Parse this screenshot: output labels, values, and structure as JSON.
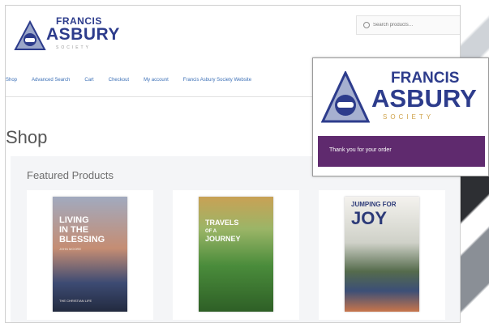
{
  "header": {
    "logo": {
      "line1": "FRANCIS",
      "line2": "ASBURY",
      "line3": "SOCIETY"
    },
    "search": {
      "placeholder": "Search products…"
    }
  },
  "nav": {
    "items": [
      "Shop",
      "Advanced Search",
      "Cart",
      "Checkout",
      "My account",
      "Francis Asbury Society Website"
    ]
  },
  "page": {
    "title": "Shop",
    "featured_title": "Featured Products"
  },
  "products": [
    {
      "title_line1": "LIVING",
      "title_line2": "IN THE",
      "title_line3": "BLESSING",
      "byline": "JOHN MOORE",
      "subtitle": "THE CHRISTIAN LIFE"
    },
    {
      "title_line1": "TRAVELS",
      "title_line2": "OF A",
      "title_line3": "JOURNEY"
    },
    {
      "title_line1": "JUMPING FOR",
      "title_line2": "JOY"
    }
  ],
  "overlay": {
    "logo": {
      "line1": "FRANCIS",
      "line2": "ASBURY",
      "line3": "SOCIETY"
    },
    "message": "Thank you for your order"
  },
  "colors": {
    "brand_blue": "#2d3c8c",
    "accent_gold": "#cfa24a",
    "banner_purple": "#5f2a6e",
    "nav_link": "#3b6fb6"
  }
}
